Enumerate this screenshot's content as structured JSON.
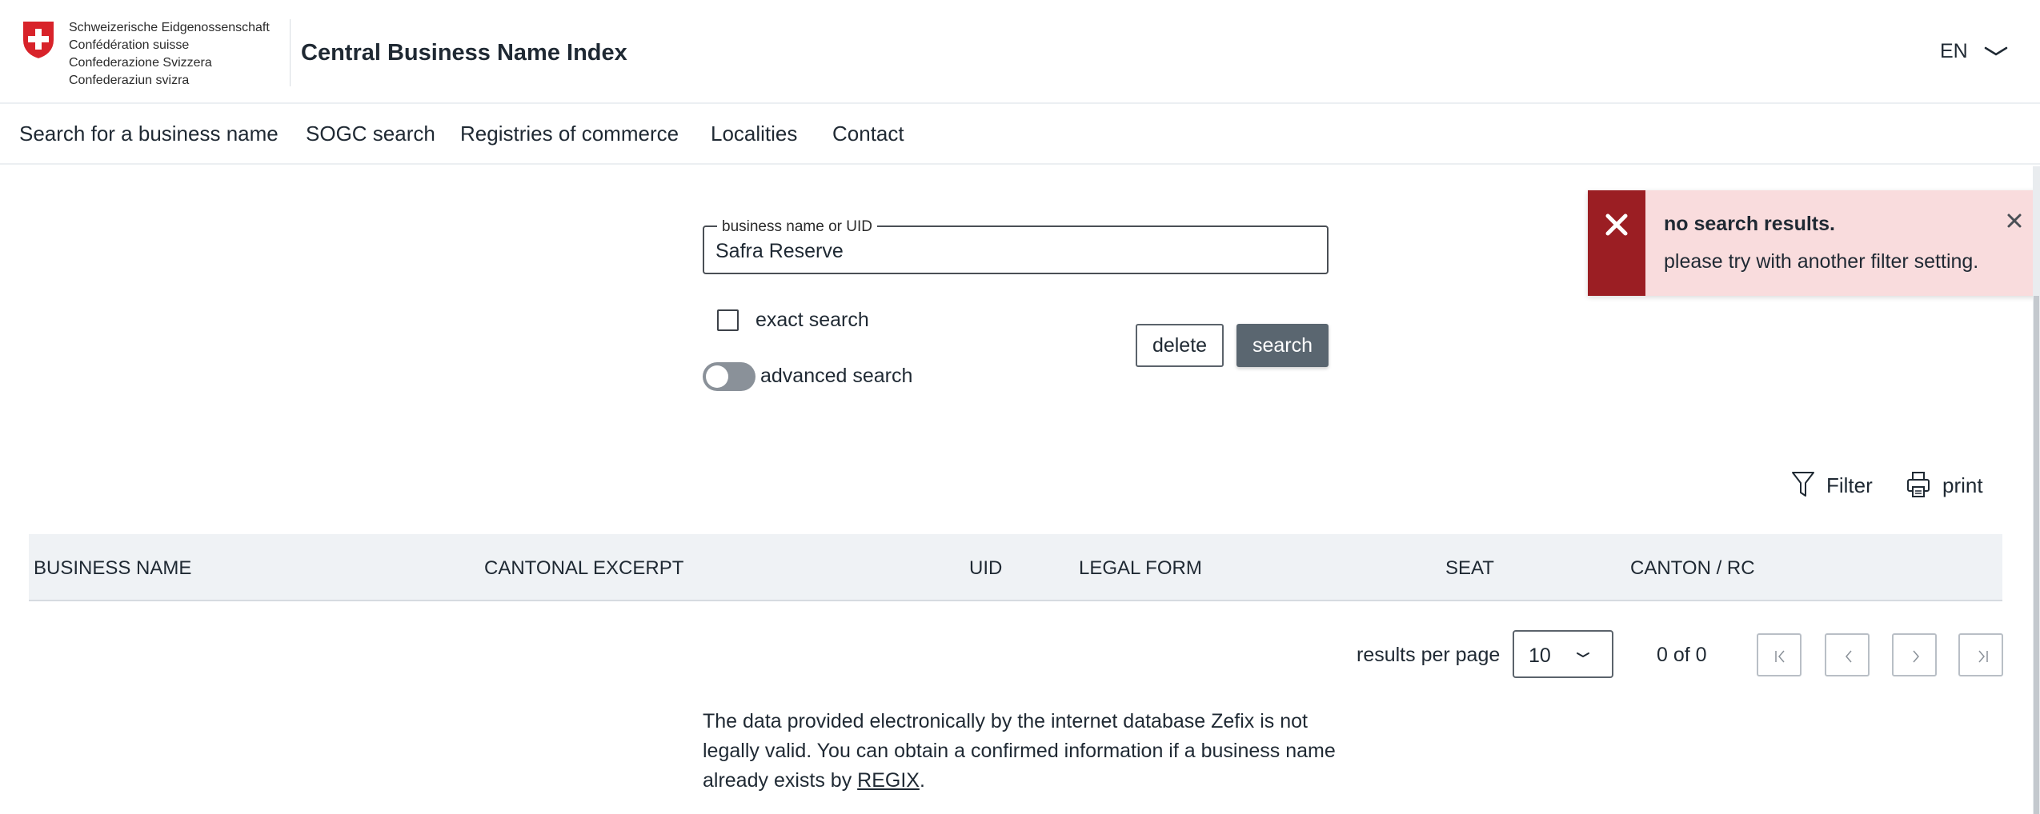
{
  "header": {
    "confederation_lines": [
      "Schweizerische Eidgenossenschaft",
      "Confédération suisse",
      "Confederazione Svizzera",
      "Confederaziun svizra"
    ],
    "app_title": "Central Business Name Index",
    "language": "EN"
  },
  "nav": {
    "items": [
      {
        "label": "Search for a business name"
      },
      {
        "label": "SOGC search"
      },
      {
        "label": "Registries of commerce"
      },
      {
        "label": "Localities"
      },
      {
        "label": "Contact"
      }
    ]
  },
  "search": {
    "field_label": "business name or UID",
    "value": "Safra Reserve",
    "exact_search_label": "exact search",
    "exact_search_checked": false,
    "advanced_search_label": "advanced search",
    "advanced_search_on": false,
    "delete_label": "delete",
    "search_label": "search"
  },
  "toast": {
    "title": "no search results.",
    "message": "please try with another filter setting."
  },
  "actions": {
    "filter_label": "Filter",
    "print_label": "print"
  },
  "table": {
    "columns": [
      "BUSINESS NAME",
      "CANTONAL EXCERPT",
      "UID",
      "LEGAL FORM",
      "SEAT",
      "CANTON / RC"
    ]
  },
  "pagination": {
    "results_per_page_label": "results per page",
    "results_per_page_value": "10",
    "page_count": "0 of 0"
  },
  "footer": {
    "disclaimer_text": "The data provided electronically by the internet database Zefix is not legally valid. You can obtain a confirmed information if a business name already exists by ",
    "link_label": "REGIX",
    "disclaimer_end": "."
  },
  "colors": {
    "toast_accent": "#9b1e23",
    "toast_background": "#f9dcdd",
    "primary_button": "#5a6670",
    "swiss_red": "#d8232a"
  }
}
